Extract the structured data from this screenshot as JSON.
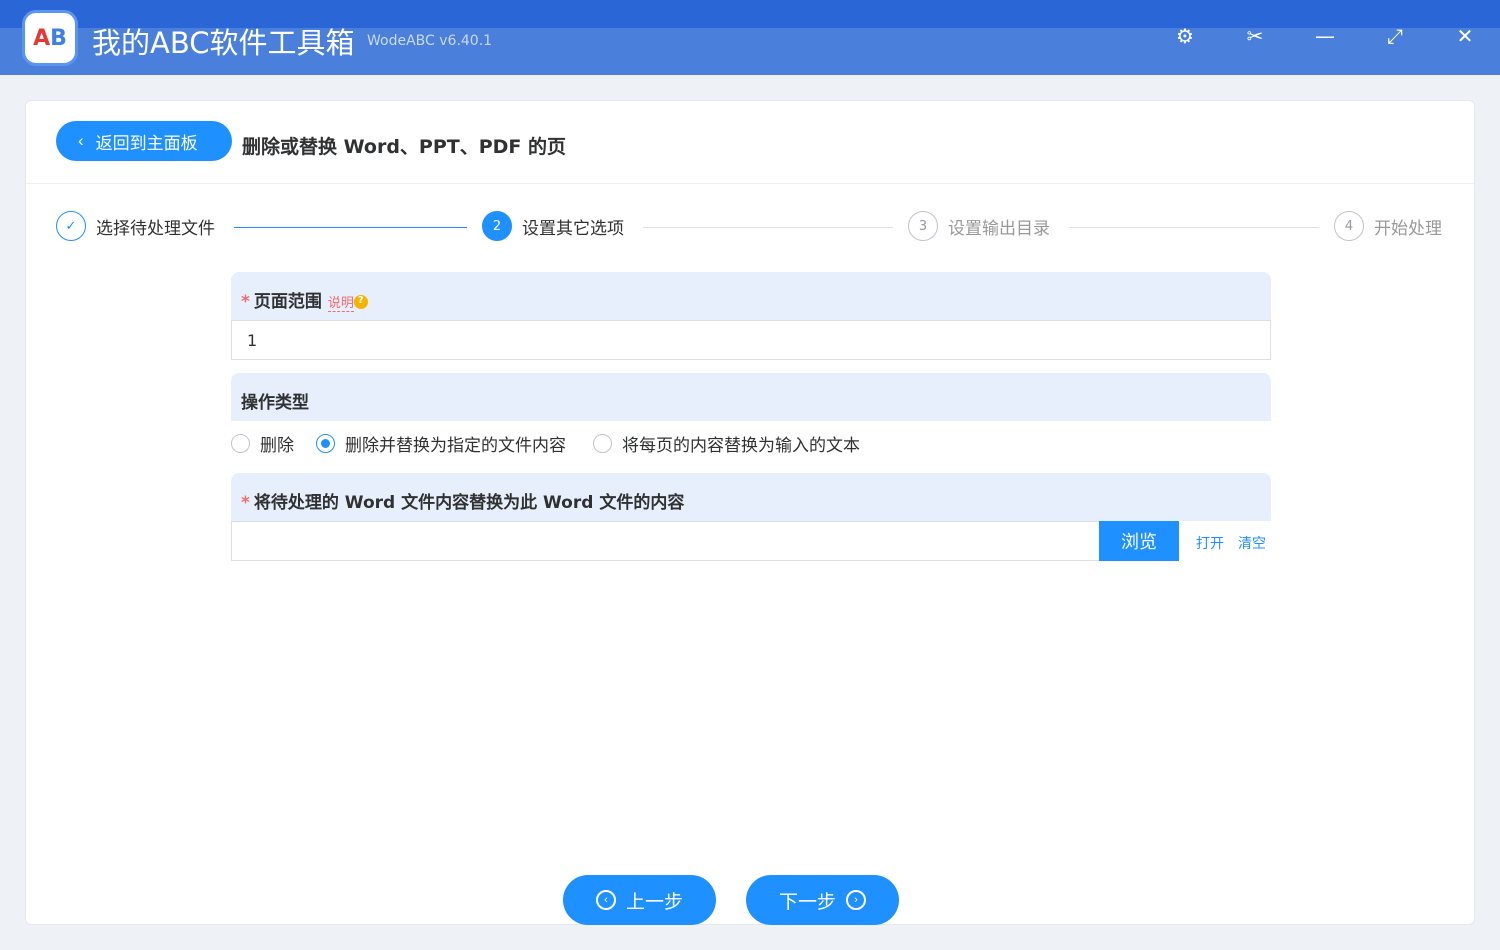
{
  "app": {
    "title": "我的ABC软件工具箱",
    "version": "WodeABC v6.40.1",
    "logo_text": "AB"
  },
  "window": {
    "settings": "⚙",
    "scissors": "✂",
    "minimize": "—",
    "maximize": "⤢",
    "close": "✕"
  },
  "header": {
    "back": "返回到主面板",
    "title": "删除或替换 Word、PPT、PDF 的页"
  },
  "steps": [
    {
      "num": "✓",
      "label": "选择待处理文件"
    },
    {
      "num": "2",
      "label": "设置其它选项"
    },
    {
      "num": "3",
      "label": "设置输出目录"
    },
    {
      "num": "4",
      "label": "开始处理"
    }
  ],
  "page_range": {
    "label": "页面范围",
    "help": "说明",
    "value": "1"
  },
  "op_type": {
    "label": "操作类型",
    "options": [
      "删除",
      "删除并替换为指定的文件内容",
      "将每页的内容替换为输入的文本"
    ],
    "selected": 1
  },
  "replace_file": {
    "label": "将待处理的 Word 文件内容替换为此 Word 文件的内容",
    "value": "",
    "browse": "浏览",
    "open": "打开",
    "clear": "清空"
  },
  "footer": {
    "prev": "上一步",
    "next": "下一步"
  }
}
